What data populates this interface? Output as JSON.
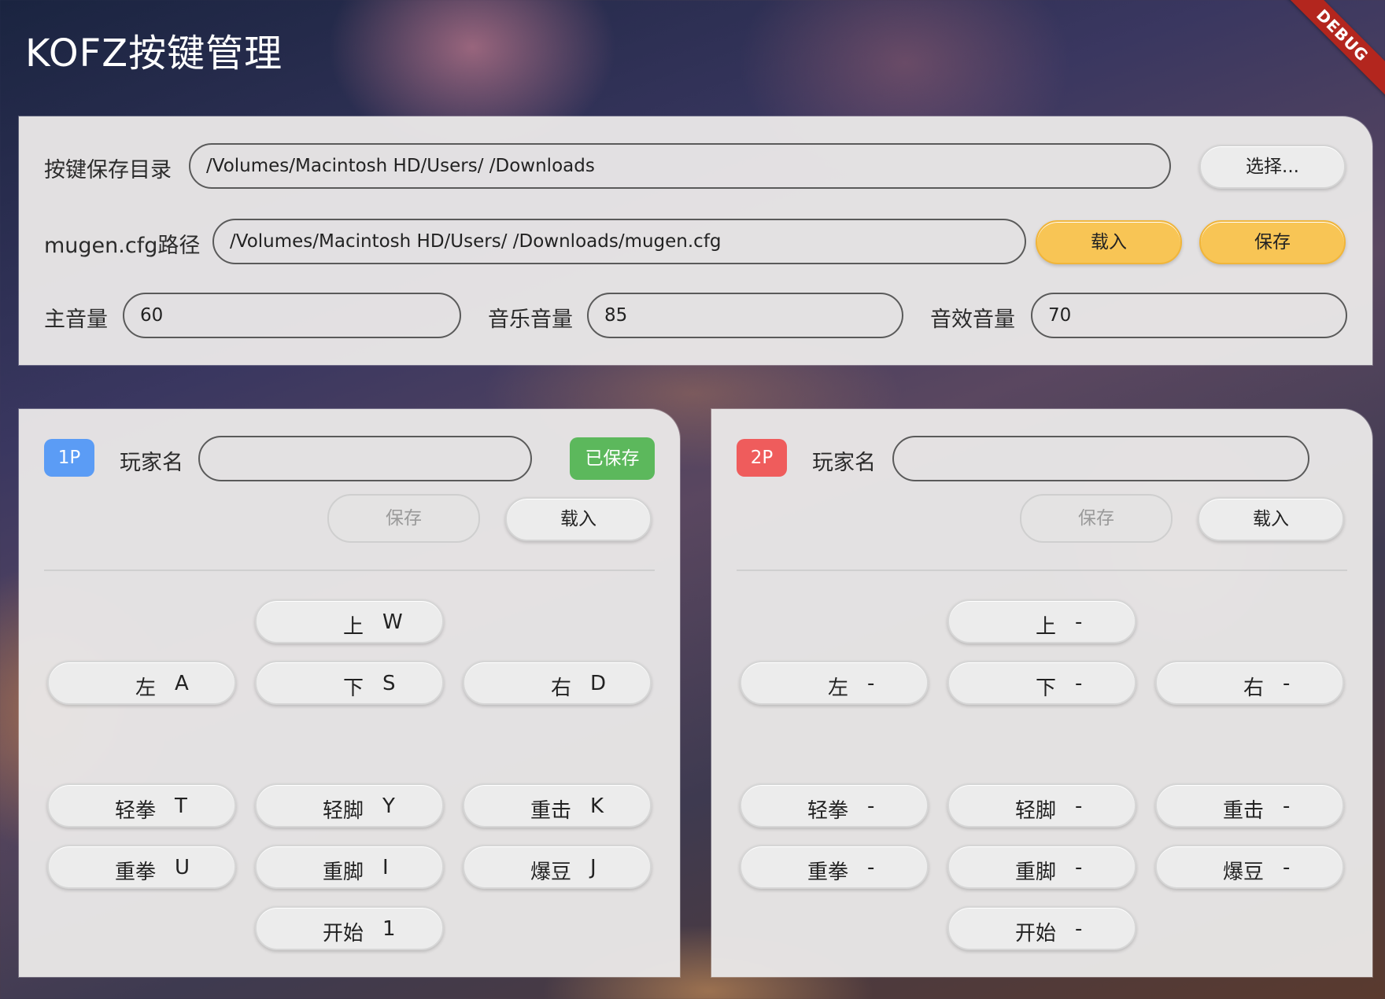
{
  "app": {
    "title": "KOFZ按键管理",
    "debug_label": "DEBUG"
  },
  "settings": {
    "save_dir_label": "按键保存目录",
    "save_dir_value": "/Volumes/Macintosh HD/Users/            /Downloads",
    "choose_button": "选择...",
    "cfg_label": "mugen.cfg路径",
    "cfg_value": "/Volumes/Macintosh HD/Users/            /Downloads/mugen.cfg",
    "load_button": "载入",
    "save_button": "保存",
    "master_volume_label": "主音量",
    "master_volume": "60",
    "music_volume_label": "音乐音量",
    "music_volume": "85",
    "sfx_volume_label": "音效音量",
    "sfx_volume": "70"
  },
  "p1": {
    "badge": "1P",
    "name_label": "玩家名",
    "name_value": "",
    "status": "已保存",
    "save_button": "保存",
    "load_button": "载入",
    "keys": {
      "up": {
        "name": "上",
        "key": "W"
      },
      "left": {
        "name": "左",
        "key": "A"
      },
      "down": {
        "name": "下",
        "key": "S"
      },
      "right": {
        "name": "右",
        "key": "D"
      },
      "lp": {
        "name": "轻拳",
        "key": "T"
      },
      "lk": {
        "name": "轻脚",
        "key": "Y"
      },
      "strike": {
        "name": "重击",
        "key": "K"
      },
      "hp": {
        "name": "重拳",
        "key": "U"
      },
      "hk": {
        "name": "重脚",
        "key": "I"
      },
      "burst": {
        "name": "爆豆",
        "key": "J"
      },
      "start": {
        "name": "开始",
        "key": "1"
      }
    }
  },
  "p2": {
    "badge": "2P",
    "name_label": "玩家名",
    "name_value": "",
    "save_button": "保存",
    "load_button": "载入",
    "keys": {
      "up": {
        "name": "上",
        "key": "-"
      },
      "left": {
        "name": "左",
        "key": "-"
      },
      "down": {
        "name": "下",
        "key": "-"
      },
      "right": {
        "name": "右",
        "key": "-"
      },
      "lp": {
        "name": "轻拳",
        "key": "-"
      },
      "lk": {
        "name": "轻脚",
        "key": "-"
      },
      "strike": {
        "name": "重击",
        "key": "-"
      },
      "hp": {
        "name": "重拳",
        "key": "-"
      },
      "hk": {
        "name": "重脚",
        "key": "-"
      },
      "burst": {
        "name": "爆豆",
        "key": "-"
      },
      "start": {
        "name": "开始",
        "key": "-"
      }
    }
  },
  "colors": {
    "accent_yellow": "#f8c555",
    "p1_badge": "#5b9cf5",
    "p2_badge": "#ef5c5c",
    "saved_green": "#5cb85c",
    "debug_red": "#b3261e"
  }
}
